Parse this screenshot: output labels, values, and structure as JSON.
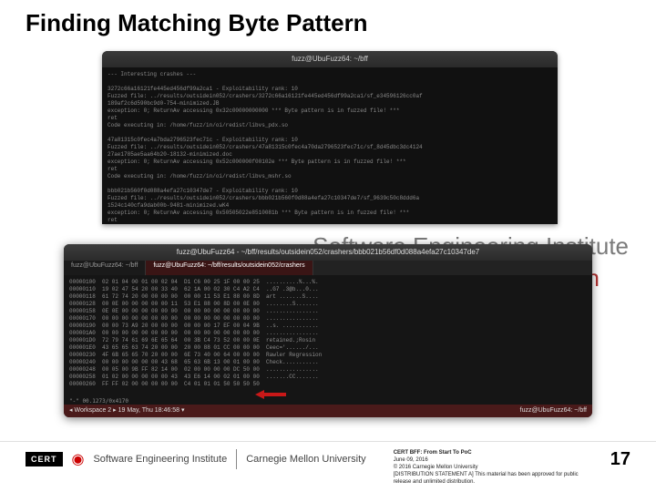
{
  "title": "Finding Matching Byte Pattern",
  "watermark_right": "Software Engineering Institute",
  "watermark_red": "lon",
  "term1": {
    "bar": "fuzz@UbuFuzz64: ~/bff",
    "lines": "--- Interesting crashes ---\n\n3272c66a16121fe445ed456df99a2ca1 - Exploitability rank: 10\nFuzzed file: ../results/outsidein052/crashers/3272c66a16121fe445ed456df99a2ca1/sf_e34596126cc0af\n189af2c6d590bc9d0-754-minimized.JB\nexception: 0; ReturnAv accessing 0x32c00000000000 *** Byte pattern is in fuzzed file! ***\nret\nCode executing in: /home/fuzz/in/oi/redist/libvs_pdx.so\n\n47a81315c0fec4a7bda2796523fec71c - Exploitability rank: 10\nFuzzed file: ../results/outsidein052/crashers/47a81315c0fec4a70da2796523fec71c/sf_8d45dbc3dc4124\n27ae1785ae5aa64b20-18132-minimized.doc\nexception: 0; ReturnAv accessing 0x52c000000f00102e *** Byte pattern is in fuzzed file! ***\nret\nCode executing in: /home/fuzz/in/oi/redist/libvs_mshr.so\n\nbbb021b560f0d088a4efa27c10347de7 - Exploitability rank: 10\nFuzzed file: ../results/outsidein052/crashers/bbb021b560f0d88a4efa27c10347de7/sf_9639c50c8ddd6a\n1524c140cfa9dab00b-9481-minimized.wK4\nexception: 0; ReturnAv accessing 0x50505022e8510081b *** Byte pattern is in fuzzed file! ***\nret\nCode executing in: /home/fuzz/in/oi/redist/libvs_wk4.so\n\n$[]"
  },
  "term2": {
    "bar": "fuzz@UbuFuzz64 - ~/bff/results/outsidein052/crashers/bbb021b56df0d088a4efa27c10347de7",
    "tab1": "fuzz@UbuFuzz64: ~/bff",
    "tab2": "fuzz@UbuFuzz64: ~/bff/results/outsidein052/crashers",
    "hex": "00000100  02 01 04 00 01 00 02 04  D1 C6 00 25 1F 00 00 25  ..........%...%.\n00000110  19 02 47 54 20 00 33 40  62 1A 00 02 30 C4 A2 C4  ..G7 .3@b...0...\n00000118  61 72 74 20 00 00 00 00  00 00 11 53 E1 88 00 8D  art .......S....\n00000128  00 0E 00 00 00 00 00 11  53 E1 88 00 8D 00 0E 00  ........S.......\n00000158  0E 0E 00 00 00 00 00 00  00 00 00 00 00 00 00 00  ................\n00000170  00 00 00 00 00 00 00 00  00 00 00 00 00 00 00 00  ................\n00000190  00 00 73 A9 20 00 00 00  00 00 00 17 EF 00 04 9B  ..s. ...........\n000001A0  00 00 00 00 00 00 00 00  00 00 00 00 00 00 00 00  ................\n000001D0  72 79 74 61 69 6E 65 64  00 3B C4 73 52 00 00 0E  retained.;Rosin\n000001E0  43 65 65 63 74 20 00 00  20 00 88 01 CC 00 00 00  Ceec='....../...\n00000230  4F 6B 65 65 70 20 00 00  6E 73 40 00 64 00 00 00  Rawler Regression\n00000240  00 00 00 00 00 00 43 68  65 63 6B 13 00 01 00 00  Check...........\n00000248  00 05 00 9B FF 82 14 00  02 00 00 00 00 DC 50 00  ................\n00000258  01 02 00 00 00 00 00 43  43 E6 14 00 02 01 00 00  .......CC.......\n00000260  FF FF 02 00 00 00 00 00  C4 01 01 01 50 50 50 50",
    "vimstatus": "\"-\"  00.1273/0x4170",
    "status_left": "◂ Workspace 2 ▸  19 May, Thu 18:46:58 ▾",
    "status_right": "fuzz@UbuFuzz64: ~/bff"
  },
  "footer": {
    "cert": "CERT",
    "sei": "Software Engineering Institute",
    "cmu": "Carnegie Mellon University",
    "line1": "CERT BFF: From Start To PoC",
    "line2": "June 09, 2016",
    "line3": "© 2016 Carnegie Mellon University",
    "line4": "[DISTRIBUTION STATEMENT A] This material has been approved for public release and unlimited distribution."
  },
  "page": "17"
}
